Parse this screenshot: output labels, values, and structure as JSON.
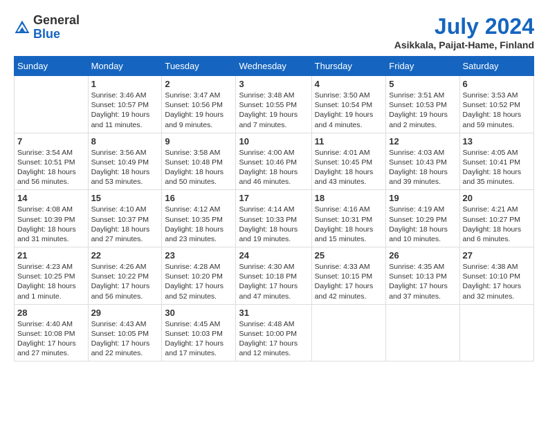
{
  "header": {
    "logo_general": "General",
    "logo_blue": "Blue",
    "month_title": "July 2024",
    "location": "Asikkala, Paijat-Hame, Finland"
  },
  "days_of_week": [
    "Sunday",
    "Monday",
    "Tuesday",
    "Wednesday",
    "Thursday",
    "Friday",
    "Saturday"
  ],
  "weeks": [
    [
      {
        "day": "",
        "info": ""
      },
      {
        "day": "1",
        "info": "Sunrise: 3:46 AM\nSunset: 10:57 PM\nDaylight: 19 hours\nand 11 minutes."
      },
      {
        "day": "2",
        "info": "Sunrise: 3:47 AM\nSunset: 10:56 PM\nDaylight: 19 hours\nand 9 minutes."
      },
      {
        "day": "3",
        "info": "Sunrise: 3:48 AM\nSunset: 10:55 PM\nDaylight: 19 hours\nand 7 minutes."
      },
      {
        "day": "4",
        "info": "Sunrise: 3:50 AM\nSunset: 10:54 PM\nDaylight: 19 hours\nand 4 minutes."
      },
      {
        "day": "5",
        "info": "Sunrise: 3:51 AM\nSunset: 10:53 PM\nDaylight: 19 hours\nand 2 minutes."
      },
      {
        "day": "6",
        "info": "Sunrise: 3:53 AM\nSunset: 10:52 PM\nDaylight: 18 hours\nand 59 minutes."
      }
    ],
    [
      {
        "day": "7",
        "info": "Sunrise: 3:54 AM\nSunset: 10:51 PM\nDaylight: 18 hours\nand 56 minutes."
      },
      {
        "day": "8",
        "info": "Sunrise: 3:56 AM\nSunset: 10:49 PM\nDaylight: 18 hours\nand 53 minutes."
      },
      {
        "day": "9",
        "info": "Sunrise: 3:58 AM\nSunset: 10:48 PM\nDaylight: 18 hours\nand 50 minutes."
      },
      {
        "day": "10",
        "info": "Sunrise: 4:00 AM\nSunset: 10:46 PM\nDaylight: 18 hours\nand 46 minutes."
      },
      {
        "day": "11",
        "info": "Sunrise: 4:01 AM\nSunset: 10:45 PM\nDaylight: 18 hours\nand 43 minutes."
      },
      {
        "day": "12",
        "info": "Sunrise: 4:03 AM\nSunset: 10:43 PM\nDaylight: 18 hours\nand 39 minutes."
      },
      {
        "day": "13",
        "info": "Sunrise: 4:05 AM\nSunset: 10:41 PM\nDaylight: 18 hours\nand 35 minutes."
      }
    ],
    [
      {
        "day": "14",
        "info": "Sunrise: 4:08 AM\nSunset: 10:39 PM\nDaylight: 18 hours\nand 31 minutes."
      },
      {
        "day": "15",
        "info": "Sunrise: 4:10 AM\nSunset: 10:37 PM\nDaylight: 18 hours\nand 27 minutes."
      },
      {
        "day": "16",
        "info": "Sunrise: 4:12 AM\nSunset: 10:35 PM\nDaylight: 18 hours\nand 23 minutes."
      },
      {
        "day": "17",
        "info": "Sunrise: 4:14 AM\nSunset: 10:33 PM\nDaylight: 18 hours\nand 19 minutes."
      },
      {
        "day": "18",
        "info": "Sunrise: 4:16 AM\nSunset: 10:31 PM\nDaylight: 18 hours\nand 15 minutes."
      },
      {
        "day": "19",
        "info": "Sunrise: 4:19 AM\nSunset: 10:29 PM\nDaylight: 18 hours\nand 10 minutes."
      },
      {
        "day": "20",
        "info": "Sunrise: 4:21 AM\nSunset: 10:27 PM\nDaylight: 18 hours\nand 6 minutes."
      }
    ],
    [
      {
        "day": "21",
        "info": "Sunrise: 4:23 AM\nSunset: 10:25 PM\nDaylight: 18 hours\nand 1 minute."
      },
      {
        "day": "22",
        "info": "Sunrise: 4:26 AM\nSunset: 10:22 PM\nDaylight: 17 hours\nand 56 minutes."
      },
      {
        "day": "23",
        "info": "Sunrise: 4:28 AM\nSunset: 10:20 PM\nDaylight: 17 hours\nand 52 minutes."
      },
      {
        "day": "24",
        "info": "Sunrise: 4:30 AM\nSunset: 10:18 PM\nDaylight: 17 hours\nand 47 minutes."
      },
      {
        "day": "25",
        "info": "Sunrise: 4:33 AM\nSunset: 10:15 PM\nDaylight: 17 hours\nand 42 minutes."
      },
      {
        "day": "26",
        "info": "Sunrise: 4:35 AM\nSunset: 10:13 PM\nDaylight: 17 hours\nand 37 minutes."
      },
      {
        "day": "27",
        "info": "Sunrise: 4:38 AM\nSunset: 10:10 PM\nDaylight: 17 hours\nand 32 minutes."
      }
    ],
    [
      {
        "day": "28",
        "info": "Sunrise: 4:40 AM\nSunset: 10:08 PM\nDaylight: 17 hours\nand 27 minutes."
      },
      {
        "day": "29",
        "info": "Sunrise: 4:43 AM\nSunset: 10:05 PM\nDaylight: 17 hours\nand 22 minutes."
      },
      {
        "day": "30",
        "info": "Sunrise: 4:45 AM\nSunset: 10:03 PM\nDaylight: 17 hours\nand 17 minutes."
      },
      {
        "day": "31",
        "info": "Sunrise: 4:48 AM\nSunset: 10:00 PM\nDaylight: 17 hours\nand 12 minutes."
      },
      {
        "day": "",
        "info": ""
      },
      {
        "day": "",
        "info": ""
      },
      {
        "day": "",
        "info": ""
      }
    ]
  ]
}
